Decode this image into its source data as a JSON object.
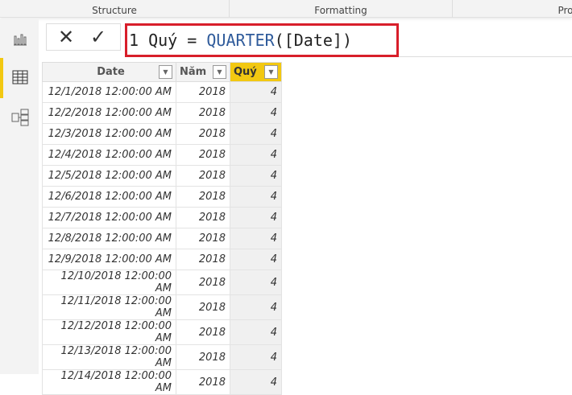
{
  "ribbon": {
    "sections": [
      "Structure",
      "Formatting",
      "Pro"
    ]
  },
  "formula": {
    "line": "1",
    "name": "Quý",
    "eq": "=",
    "func": "QUARTER",
    "arg": "([Date])"
  },
  "table": {
    "columns": [
      "Date",
      "Năm",
      "Quý"
    ],
    "rows": [
      [
        "12/1/2018 12:00:00 AM",
        "2018",
        "4"
      ],
      [
        "12/2/2018 12:00:00 AM",
        "2018",
        "4"
      ],
      [
        "12/3/2018 12:00:00 AM",
        "2018",
        "4"
      ],
      [
        "12/4/2018 12:00:00 AM",
        "2018",
        "4"
      ],
      [
        "12/5/2018 12:00:00 AM",
        "2018",
        "4"
      ],
      [
        "12/6/2018 12:00:00 AM",
        "2018",
        "4"
      ],
      [
        "12/7/2018 12:00:00 AM",
        "2018",
        "4"
      ],
      [
        "12/8/2018 12:00:00 AM",
        "2018",
        "4"
      ],
      [
        "12/9/2018 12:00:00 AM",
        "2018",
        "4"
      ],
      [
        "12/10/2018 12:00:00 AM",
        "2018",
        "4"
      ],
      [
        "12/11/2018 12:00:00 AM",
        "2018",
        "4"
      ],
      [
        "12/12/2018 12:00:00 AM",
        "2018",
        "4"
      ],
      [
        "12/13/2018 12:00:00 AM",
        "2018",
        "4"
      ],
      [
        "12/14/2018 12:00:00 AM",
        "2018",
        "4"
      ]
    ]
  }
}
